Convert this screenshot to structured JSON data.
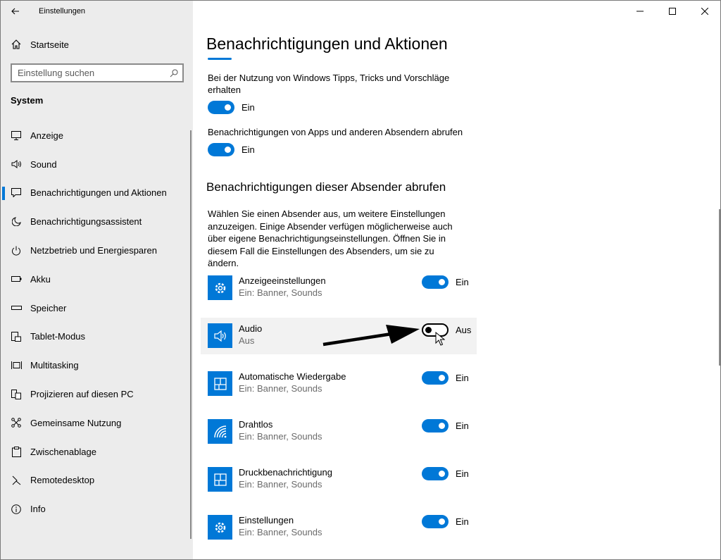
{
  "window": {
    "title": "Einstellungen",
    "controls": [
      "minimize-icon",
      "maximize-icon",
      "close-icon"
    ]
  },
  "sidebar": {
    "home_label": "Startseite",
    "search_placeholder": "Einstellung suchen",
    "section": "System",
    "items": [
      {
        "label": "Anzeige",
        "icon": "display-icon",
        "active": false
      },
      {
        "label": "Sound",
        "icon": "speaker-icon",
        "active": false
      },
      {
        "label": "Benachrichtigungen und Aktionen",
        "icon": "notification-icon",
        "active": true
      },
      {
        "label": "Benachrichtigungsassistent",
        "icon": "moon-icon",
        "active": false
      },
      {
        "label": "Netzbetrieb und Energiesparen",
        "icon": "power-icon",
        "active": false
      },
      {
        "label": "Akku",
        "icon": "battery-icon",
        "active": false
      },
      {
        "label": "Speicher",
        "icon": "storage-icon",
        "active": false
      },
      {
        "label": "Tablet-Modus",
        "icon": "tablet-icon",
        "active": false
      },
      {
        "label": "Multitasking",
        "icon": "multitasking-icon",
        "active": false
      },
      {
        "label": "Projizieren auf diesen PC",
        "icon": "project-icon",
        "active": false
      },
      {
        "label": "Gemeinsame Nutzung",
        "icon": "share-icon",
        "active": false
      },
      {
        "label": "Zwischenablage",
        "icon": "clipboard-icon",
        "active": false
      },
      {
        "label": "Remotedesktop",
        "icon": "remote-icon",
        "active": false
      },
      {
        "label": "Info",
        "icon": "info-icon",
        "active": false
      }
    ]
  },
  "main": {
    "title": "Benachrichtigungen und Aktionen",
    "tips": {
      "label": "Bei der Nutzung von Windows Tipps, Tricks und Vorschläge erhalten",
      "state": "Ein"
    },
    "apps": {
      "label": "Benachrichtigungen von Apps und anderen Absendern abrufen",
      "state": "Ein"
    },
    "senders_heading": "Benachrichtigungen dieser Absender abrufen",
    "senders_desc": "Wählen Sie einen Absender aus, um weitere Einstellungen anzuzeigen. Einige Absender verfügen möglicherweise auch über eigene Benachrichtigungseinstellungen. Öffnen Sie in diesem Fall die Einstellungen des Absenders, um sie zu ändern.",
    "senders": [
      {
        "name": "Anzeigeeinstellungen",
        "sub": "Ein: Banner, Sounds",
        "state": "Ein",
        "icon": "gear-icon"
      },
      {
        "name": "Audio",
        "sub": "Aus",
        "state": "Aus",
        "icon": "speaker-icon"
      },
      {
        "name": "Automatische Wiedergabe",
        "sub": "Ein: Banner, Sounds",
        "state": "Ein",
        "icon": "autoplay-icon"
      },
      {
        "name": "Drahtlos",
        "sub": "Ein: Banner, Sounds",
        "state": "Ein",
        "icon": "wireless-icon"
      },
      {
        "name": "Druckbenachrichtigung",
        "sub": "Ein: Banner, Sounds",
        "state": "Ein",
        "icon": "print-notification-icon"
      },
      {
        "name": "Einstellungen",
        "sub": "Ein: Banner, Sounds",
        "state": "Ein",
        "icon": "gear-icon"
      }
    ]
  },
  "colors": {
    "accent": "#0078d7",
    "sidebar_bg": "#ececec"
  }
}
